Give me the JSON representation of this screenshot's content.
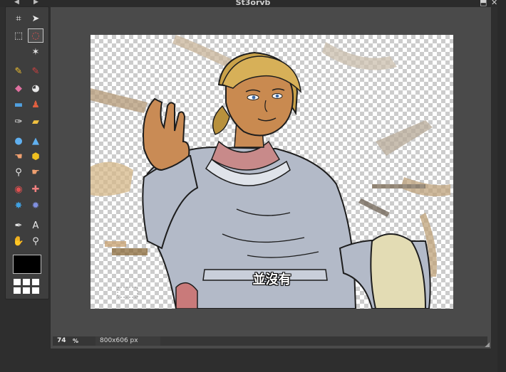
{
  "app": {
    "window_title": "St3orvb",
    "nav_prev_icon": "chevron-left-icon",
    "nav_next_icon": "chevron-right-icon",
    "window_controls": {
      "maximize_icon": "maximize-icon",
      "close_icon": "close-icon"
    }
  },
  "toolbox": {
    "tools": [
      {
        "icon": "crop-icon",
        "glyph": "⌗",
        "color": "#e8e8e8",
        "active": false
      },
      {
        "icon": "move-icon",
        "glyph": "➤",
        "color": "#e8e8e8",
        "active": false
      },
      {
        "icon": "marquee-select-icon",
        "glyph": "⬚",
        "color": "#e8e8e8",
        "active": false
      },
      {
        "icon": "lasso-icon",
        "glyph": "◌",
        "color": "#e05050",
        "active": true
      },
      {
        "icon": "magic-wand-icon",
        "glyph": "✶",
        "color": "#e8e8e8",
        "active": false
      },
      {
        "icon": "pencil-icon",
        "glyph": "✎",
        "color": "#f0c030",
        "active": false
      },
      {
        "icon": "brush-icon",
        "glyph": "✎",
        "color": "#d04040",
        "active": false
      },
      {
        "icon": "eraser-icon",
        "glyph": "◆",
        "color": "#e070a0",
        "active": false
      },
      {
        "icon": "paint-bucket-icon",
        "glyph": "◕",
        "color": "#e8e8e8",
        "active": false
      },
      {
        "icon": "gradient-icon",
        "glyph": "▬",
        "color": "#50a0e0",
        "active": false
      },
      {
        "icon": "clone-stamp-icon",
        "glyph": "♟",
        "color": "#e06040",
        "active": false
      },
      {
        "icon": "color-replace-icon",
        "glyph": "✑",
        "color": "#e8e8e8",
        "active": false
      },
      {
        "icon": "draw-shape-icon",
        "glyph": "▰",
        "color": "#f0c040",
        "active": false
      },
      {
        "icon": "blur-icon",
        "glyph": "●",
        "color": "#60b0f0",
        "active": false
      },
      {
        "icon": "sharpen-icon",
        "glyph": "▲",
        "color": "#60b0f0",
        "active": false
      },
      {
        "icon": "smudge-icon",
        "glyph": "☚",
        "color": "#f0a070",
        "active": false
      },
      {
        "icon": "sponge-icon",
        "glyph": "⬢",
        "color": "#f0c020",
        "active": false
      },
      {
        "icon": "dodge-icon",
        "glyph": "⚲",
        "color": "#e8e8e8",
        "active": false
      },
      {
        "icon": "burn-icon",
        "glyph": "☛",
        "color": "#f0a070",
        "active": false
      },
      {
        "icon": "red-eye-icon",
        "glyph": "◉",
        "color": "#e05050",
        "active": false
      },
      {
        "icon": "spot-heal-icon",
        "glyph": "✚",
        "color": "#f08080",
        "active": false
      },
      {
        "icon": "bloat-icon",
        "glyph": "✸",
        "color": "#40a0e0",
        "active": false
      },
      {
        "icon": "pinch-icon",
        "glyph": "✹",
        "color": "#8090e0",
        "active": false
      },
      {
        "icon": "color-picker-icon",
        "glyph": "✒",
        "color": "#e8e8e8",
        "active": false
      },
      {
        "icon": "type-icon",
        "glyph": "A",
        "color": "#e8e8e8",
        "active": false
      },
      {
        "icon": "hand-icon",
        "glyph": "✋",
        "color": "#f0b070",
        "active": false
      },
      {
        "icon": "zoom-icon",
        "glyph": "⚲",
        "color": "#e8e8e8",
        "active": false
      }
    ],
    "foreground_color": "#000000",
    "layout_icon": "grid-layout-icon"
  },
  "canvas": {
    "subtitle": "並沒有"
  },
  "status": {
    "zoom_value": "74",
    "zoom_unit": "%",
    "dimensions": "800x606 px"
  }
}
